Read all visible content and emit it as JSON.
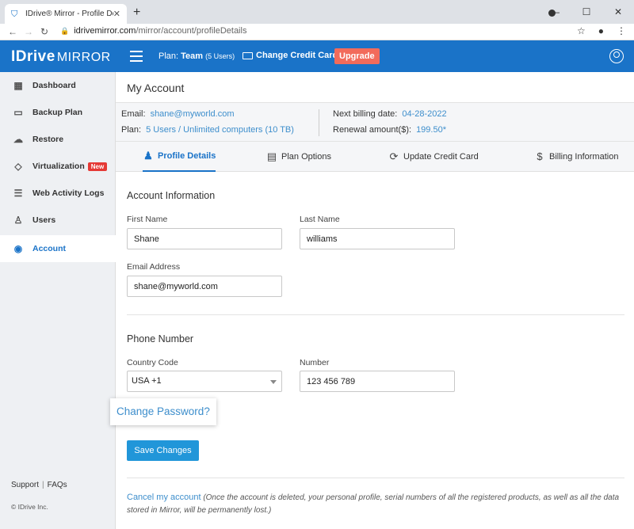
{
  "browser": {
    "tab_title": "IDrive® Mirror - Profile Details",
    "url_host": "idrivemirror.com",
    "url_path": "/mirror/account/profileDetails"
  },
  "header": {
    "logo": "IDrive",
    "logo_sub": "MIRROR",
    "plan_label": "Plan:",
    "plan_name": "Team",
    "plan_users": "(5 Users)",
    "change_cc": "Change Credit Card",
    "upgrade": "Upgrade"
  },
  "sidebar": {
    "items": [
      {
        "label": "Dashboard",
        "icon": "dashboard-icon"
      },
      {
        "label": "Backup Plan",
        "icon": "monitor-icon"
      },
      {
        "label": "Restore",
        "icon": "cloud-download-icon"
      },
      {
        "label": "Virtualization",
        "icon": "cube-icon",
        "badge": "New"
      },
      {
        "label": "Web Activity Logs",
        "icon": "log-icon"
      },
      {
        "label": "Users",
        "icon": "users-icon"
      },
      {
        "label": "Account",
        "icon": "account-icon"
      }
    ],
    "support": "Support",
    "faqs": "FAQs",
    "copyright": "© IDrive Inc."
  },
  "page": {
    "title": "My Account",
    "email_label": "Email:",
    "email_value": "shane@myworld.com",
    "plan_label": "Plan:",
    "plan_value": "5 Users / Unlimited computers (10 TB)",
    "billing_label": "Next billing date:",
    "billing_value": "04-28-2022",
    "renewal_label": "Renewal amount($):",
    "renewal_value": "199.50*"
  },
  "tabs": [
    "Profile Details",
    "Plan Options",
    "Update Credit Card",
    "Billing Information"
  ],
  "form": {
    "account_title": "Account Information",
    "first_name_label": "First Name",
    "first_name": "Shane",
    "last_name_label": "Last Name",
    "last_name": "williams",
    "email_label": "Email Address",
    "email": "shane@myworld.com",
    "phone_title": "Phone Number",
    "country_label": "Country Code",
    "country": "USA +1",
    "number_label": "Number",
    "number": "123 456 789",
    "change_password": "Change Password?",
    "save": "Save Changes",
    "cancel_link": "Cancel my account",
    "cancel_note": "(Once the account is deleted, your personal profile, serial numbers of all the registered products, as well as all the data stored in Mirror, will be permanently lost.)"
  },
  "colors": {
    "brand": "#1a73c8",
    "upgrade": "#f26b5b",
    "link": "#3d8ecc",
    "save_button": "#2196d9"
  }
}
